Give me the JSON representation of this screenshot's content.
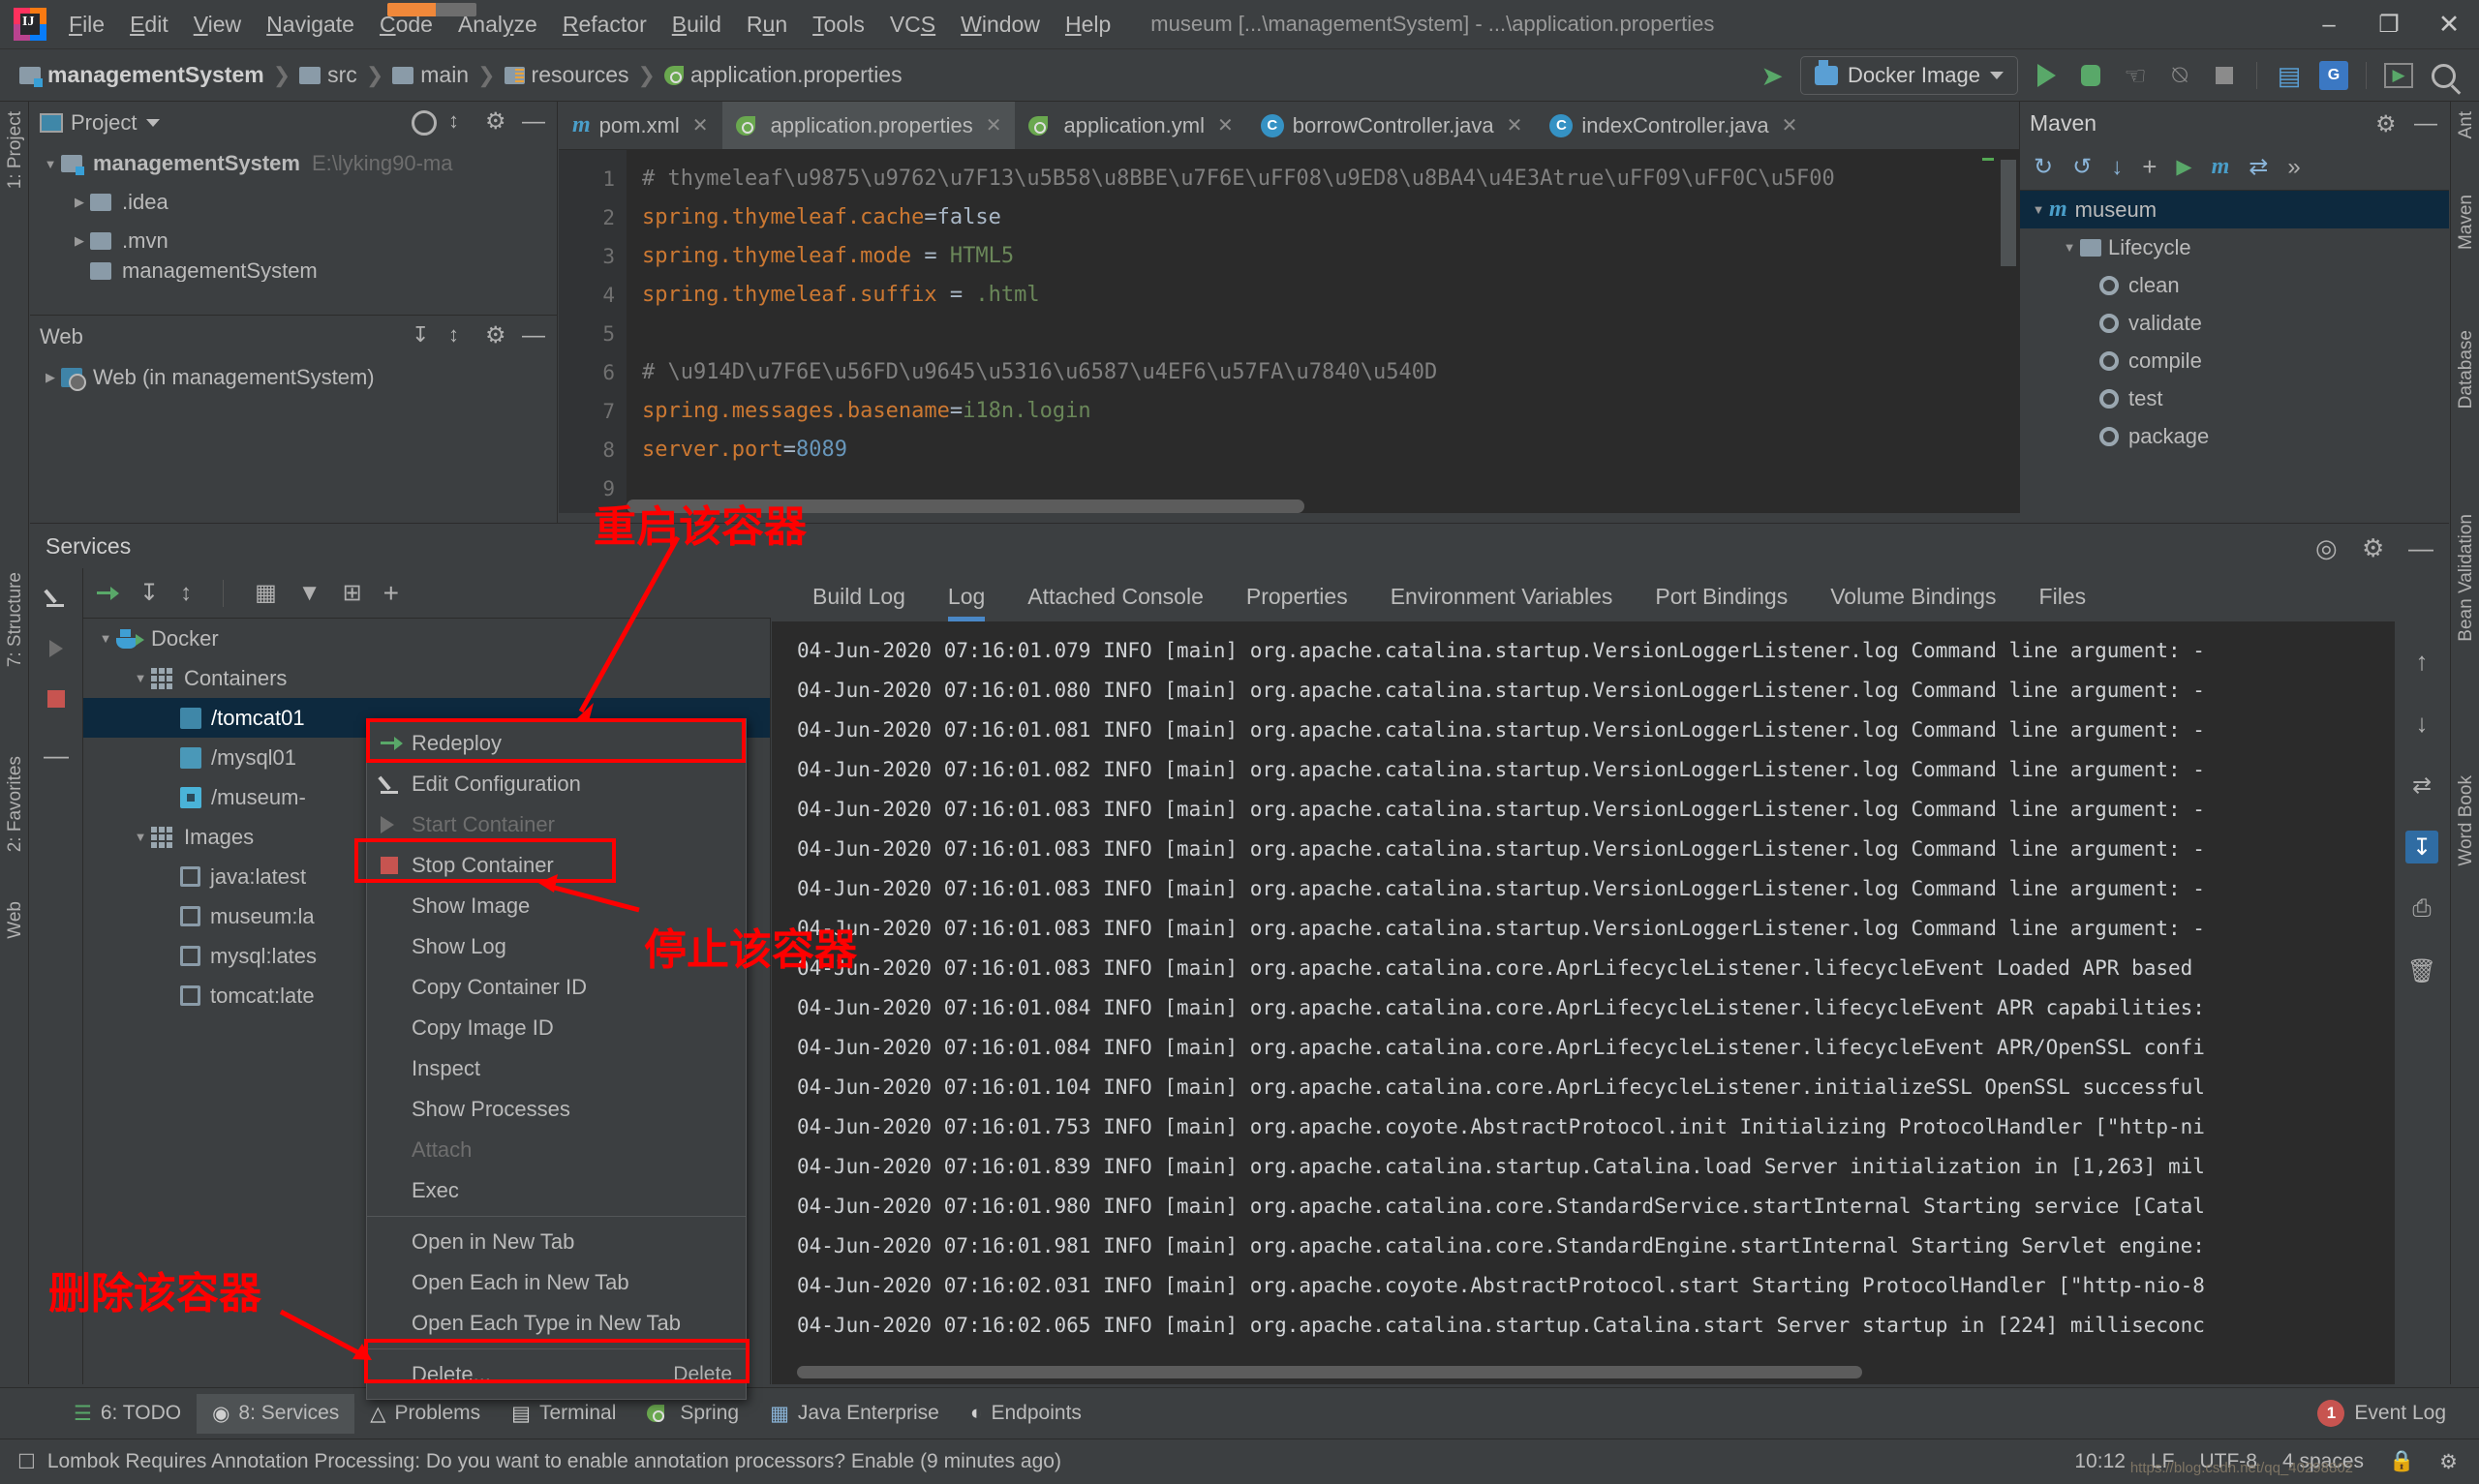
{
  "app": {
    "window_title": "museum [...\\managementSystem] - ...\\application.properties",
    "menu": [
      "File",
      "Edit",
      "View",
      "Navigate",
      "Code",
      "Analyze",
      "Refactor",
      "Build",
      "Run",
      "Tools",
      "VCS",
      "Window",
      "Help"
    ],
    "window_controls": {
      "minimize": "–",
      "restore": "❐",
      "close": "✕"
    }
  },
  "breadcrumb": {
    "items": [
      {
        "label": "managementSystem",
        "icon": "module-folder-icon"
      },
      {
        "label": "src",
        "icon": "folder-icon"
      },
      {
        "label": "main",
        "icon": "folder-icon"
      },
      {
        "label": "resources",
        "icon": "resources-folder-icon"
      },
      {
        "label": "application.properties",
        "icon": "spring-leaf-icon"
      }
    ],
    "separator": "❯"
  },
  "toolbar": {
    "run_config": "Docker Image",
    "icons": [
      "back-arrow-icon",
      "docker-image-icon",
      "run-icon",
      "debug-icon",
      "run-with-coverage-icon",
      "profile-icon",
      "stop-icon",
      "project-structure-icon",
      "translate-icon",
      "terminal-icon",
      "search-everywhere-icon"
    ]
  },
  "left_strip": {
    "tabs": [
      "1: Project",
      "7: Structure",
      "2: Favorites",
      "Web"
    ]
  },
  "right_strip": {
    "tabs": [
      "Ant",
      "Maven",
      "Database",
      "Bean Validation",
      "Word Book"
    ]
  },
  "project_panel": {
    "title": "Project",
    "tree": [
      {
        "label": "managementSystem",
        "path": "E:\\lyking90-ma",
        "arrow": "▼",
        "icon": "module-folder-icon",
        "depth": 0,
        "bold": true
      },
      {
        "label": ".idea",
        "path": "",
        "arrow": "▶",
        "icon": "folder-icon",
        "depth": 1,
        "bold": false
      },
      {
        "label": ".mvn",
        "path": "",
        "arrow": "▶",
        "icon": "folder-icon",
        "depth": 1,
        "bold": false
      },
      {
        "label": "managementSystem",
        "path": "",
        "arrow": "",
        "icon": "folder-icon",
        "depth": 1,
        "bold": false
      }
    ]
  },
  "web_panel": {
    "title": "Web",
    "tree": [
      {
        "label": "Web (in managementSystem)",
        "arrow": "▶",
        "icon": "web-module-icon"
      }
    ]
  },
  "editor": {
    "tabs": [
      {
        "label": "pom.xml",
        "icon": "maven-m-icon",
        "active": false,
        "closeable": true
      },
      {
        "label": "application.properties",
        "icon": "spring-leaf-icon",
        "active": true,
        "closeable": true
      },
      {
        "label": "application.yml",
        "icon": "spring-leaf-icon",
        "active": false,
        "closeable": true
      },
      {
        "label": "borrowController.java",
        "icon": "java-class-icon",
        "active": false,
        "closeable": true
      },
      {
        "label": "indexController.java",
        "icon": "java-class-icon",
        "active": false,
        "closeable": true
      }
    ],
    "lines": [
      {
        "no": "1",
        "kind": "comment",
        "text": "# thymeleaf\\u9875\\u9762\\u7F13\\u5B58\\u8BBE\\u7F6E\\uFF08\\u9ED8\\u8BA4\\u4E3Atrue\\uFF09\\uFF0C\\u5F00"
      },
      {
        "no": "2",
        "kind": "kv",
        "key": "spring.thymeleaf.cache",
        "op": "=",
        "value": "false",
        "valkind": "plain"
      },
      {
        "no": "3",
        "kind": "kv",
        "key": "spring.thymeleaf.mode",
        "op": " = ",
        "value": "HTML5",
        "valkind": "green"
      },
      {
        "no": "4",
        "kind": "kv",
        "key": "spring.thymeleaf.suffix",
        "op": " = ",
        "value": ".html",
        "valkind": "green"
      },
      {
        "no": "5",
        "kind": "blank",
        "text": ""
      },
      {
        "no": "6",
        "kind": "comment",
        "text": "# \\u914D\\u7F6E\\u56FD\\u9645\\u5316\\u6587\\u4EF6\\u57FA\\u7840\\u540D"
      },
      {
        "no": "7",
        "kind": "kv",
        "key": "spring.messages.basename",
        "op": "=",
        "value": "i18n.login",
        "valkind": "green"
      },
      {
        "no": "8",
        "kind": "kv",
        "key": "server.port",
        "op": "=",
        "value": "8089",
        "valkind": "num"
      },
      {
        "no": "9",
        "kind": "blank",
        "text": ""
      }
    ]
  },
  "services": {
    "title": "Services",
    "toolbar_icons": [
      "redeploy-icon",
      "expand-all-icon",
      "collapse-all-icon",
      "group-by-icon",
      "filter-icon",
      "add-tab-icon",
      "add-icon"
    ],
    "side_icons": [
      "edit-configuration-icon",
      "start-container-icon",
      "stop-container-icon",
      "remove-icon"
    ],
    "tree": [
      {
        "label": "Docker",
        "arrow": "▼",
        "icon": "docker-whale-icon",
        "depth": 0,
        "selected": false
      },
      {
        "label": "Containers",
        "arrow": "▼",
        "icon": "containers-grid-icon",
        "depth": 1,
        "selected": false
      },
      {
        "label": "/tomcat01",
        "arrow": "",
        "icon": "container-running-icon",
        "depth": 2,
        "selected": true
      },
      {
        "label": "/mysql01",
        "arrow": "",
        "icon": "container-running-icon",
        "depth": 2,
        "selected": false
      },
      {
        "label": "/museum-",
        "arrow": "",
        "icon": "container-stopped-icon",
        "depth": 2,
        "selected": false
      },
      {
        "label": "Images",
        "arrow": "▼",
        "icon": "images-grid-icon",
        "depth": 1,
        "selected": false
      },
      {
        "label": "java:latest",
        "arrow": "",
        "icon": "image-icon",
        "depth": 2,
        "selected": false
      },
      {
        "label": "museum:la",
        "arrow": "",
        "icon": "image-icon",
        "depth": 2,
        "selected": false
      },
      {
        "label": "mysql:lates",
        "arrow": "",
        "icon": "image-icon",
        "depth": 2,
        "selected": false
      },
      {
        "label": "tomcat:late",
        "arrow": "",
        "icon": "image-icon",
        "depth": 2,
        "selected": false
      }
    ]
  },
  "context_menu": {
    "items": [
      {
        "label": "Redeploy",
        "icon": "redeploy-icon",
        "shortcut": "",
        "disabled": false,
        "sep_after": false
      },
      {
        "label": "Edit Configuration",
        "icon": "pencil-icon",
        "shortcut": "",
        "disabled": false,
        "sep_after": false
      },
      {
        "label": "Start Container",
        "icon": "play-icon",
        "shortcut": "",
        "disabled": true,
        "sep_after": false
      },
      {
        "label": "Stop Container",
        "icon": "stop-icon",
        "shortcut": "",
        "disabled": false,
        "sep_after": false
      },
      {
        "label": "Show Image",
        "icon": "",
        "shortcut": "",
        "disabled": false,
        "sep_after": false
      },
      {
        "label": "Show Log",
        "icon": "",
        "shortcut": "",
        "disabled": false,
        "sep_after": false
      },
      {
        "label": "Copy Container ID",
        "icon": "",
        "shortcut": "",
        "disabled": false,
        "sep_after": false
      },
      {
        "label": "Copy Image ID",
        "icon": "",
        "shortcut": "",
        "disabled": false,
        "sep_after": false
      },
      {
        "label": "Inspect",
        "icon": "",
        "shortcut": "",
        "disabled": false,
        "sep_after": false
      },
      {
        "label": "Show Processes",
        "icon": "",
        "shortcut": "",
        "disabled": false,
        "sep_after": false
      },
      {
        "label": "Attach",
        "icon": "",
        "shortcut": "",
        "disabled": true,
        "sep_after": false
      },
      {
        "label": "Exec",
        "icon": "",
        "shortcut": "",
        "disabled": false,
        "sep_after": true
      },
      {
        "label": "Open in New Tab",
        "icon": "",
        "shortcut": "",
        "disabled": false,
        "sep_after": false
      },
      {
        "label": "Open Each in New Tab",
        "icon": "",
        "shortcut": "",
        "disabled": false,
        "sep_after": false
      },
      {
        "label": "Open Each Type in New Tab",
        "icon": "",
        "shortcut": "",
        "disabled": false,
        "sep_after": true
      },
      {
        "label": "Delete...",
        "icon": "",
        "shortcut": "Delete",
        "disabled": false,
        "sep_after": false
      }
    ]
  },
  "log_panel": {
    "tabs": [
      {
        "label": "Build Log",
        "active": false
      },
      {
        "label": "Log",
        "active": true
      },
      {
        "label": "Attached Console",
        "active": false
      },
      {
        "label": "Properties",
        "active": false
      },
      {
        "label": "Environment Variables",
        "active": false
      },
      {
        "label": "Port Bindings",
        "active": false
      },
      {
        "label": "Volume Bindings",
        "active": false
      },
      {
        "label": "Files",
        "active": false
      }
    ],
    "lines": [
      "04-Jun-2020 07:16:01.079 INFO [main] org.apache.catalina.startup.VersionLoggerListener.log Command line argument: -",
      "04-Jun-2020 07:16:01.080 INFO [main] org.apache.catalina.startup.VersionLoggerListener.log Command line argument: -",
      "04-Jun-2020 07:16:01.081 INFO [main] org.apache.catalina.startup.VersionLoggerListener.log Command line argument: -",
      "04-Jun-2020 07:16:01.082 INFO [main] org.apache.catalina.startup.VersionLoggerListener.log Command line argument: -",
      "04-Jun-2020 07:16:01.083 INFO [main] org.apache.catalina.startup.VersionLoggerListener.log Command line argument: -",
      "04-Jun-2020 07:16:01.083 INFO [main] org.apache.catalina.startup.VersionLoggerListener.log Command line argument: -",
      "04-Jun-2020 07:16:01.083 INFO [main] org.apache.catalina.startup.VersionLoggerListener.log Command line argument: -",
      "04-Jun-2020 07:16:01.083 INFO [main] org.apache.catalina.startup.VersionLoggerListener.log Command line argument: -",
      "04-Jun-2020 07:16:01.083 INFO [main] org.apache.catalina.core.AprLifecycleListener.lifecycleEvent Loaded APR based",
      "04-Jun-2020 07:16:01.084 INFO [main] org.apache.catalina.core.AprLifecycleListener.lifecycleEvent APR capabilities:",
      "04-Jun-2020 07:16:01.084 INFO [main] org.apache.catalina.core.AprLifecycleListener.lifecycleEvent APR/OpenSSL confi",
      "04-Jun-2020 07:16:01.104 INFO [main] org.apache.catalina.core.AprLifecycleListener.initializeSSL OpenSSL successful",
      "04-Jun-2020 07:16:01.753 INFO [main] org.apache.coyote.AbstractProtocol.init Initializing ProtocolHandler [\"http-ni",
      "04-Jun-2020 07:16:01.839 INFO [main] org.apache.catalina.startup.Catalina.load Server initialization in [1,263] mil",
      "04-Jun-2020 07:16:01.980 INFO [main] org.apache.catalina.core.StandardService.startInternal Starting service [Catal",
      "04-Jun-2020 07:16:01.981 INFO [main] org.apache.catalina.core.StandardEngine.startInternal Starting Servlet engine:",
      "04-Jun-2020 07:16:02.031 INFO [main] org.apache.coyote.AbstractProtocol.start Starting ProtocolHandler [\"http-nio-8",
      "04-Jun-2020 07:16:02.065 INFO [main] org.apache.catalina.startup.Catalina.start Server startup in [224] milliseconc"
    ],
    "side_icons": [
      "scroll-up-icon",
      "scroll-down-icon",
      "soft-wrap-icon",
      "scroll-to-end-icon",
      "print-icon",
      "clear-all-icon"
    ]
  },
  "maven_panel": {
    "title": "Maven",
    "tree": [
      {
        "label": "museum",
        "arrow": "▼",
        "icon": "maven-project-icon",
        "depth": 0,
        "selected": true
      },
      {
        "label": "Lifecycle",
        "arrow": "▼",
        "icon": "lifecycle-folder-icon",
        "depth": 1,
        "selected": false
      },
      {
        "label": "clean",
        "arrow": "",
        "icon": "maven-goal-icon",
        "depth": 2,
        "selected": false
      },
      {
        "label": "validate",
        "arrow": "",
        "icon": "maven-goal-icon",
        "depth": 2,
        "selected": false
      },
      {
        "label": "compile",
        "arrow": "",
        "icon": "maven-goal-icon",
        "depth": 2,
        "selected": false
      },
      {
        "label": "test",
        "arrow": "",
        "icon": "maven-goal-icon",
        "depth": 2,
        "selected": false
      },
      {
        "label": "package",
        "arrow": "",
        "icon": "maven-goal-icon",
        "depth": 2,
        "selected": false
      }
    ],
    "toolbar_icons": [
      "reload-icon",
      "generate-sources-icon",
      "download-sources-icon",
      "add-icon",
      "run-icon",
      "maven-settings-icon",
      "toggle-offline-icon",
      "more-icon"
    ]
  },
  "bottom_tool_window_bar": {
    "items": [
      {
        "label": "6: TODO",
        "icon": "todo-icon",
        "selected": false
      },
      {
        "label": "8: Services",
        "icon": "services-icon",
        "selected": true
      },
      {
        "label": "Problems",
        "icon": "problems-icon",
        "selected": false
      },
      {
        "label": "Terminal",
        "icon": "terminal-icon",
        "selected": false
      },
      {
        "label": "Spring",
        "icon": "spring-leaf-icon",
        "selected": false
      },
      {
        "label": "Java Enterprise",
        "icon": "java-enterprise-icon",
        "selected": false
      },
      {
        "label": "Endpoints",
        "icon": "endpoints-icon",
        "selected": false
      }
    ],
    "event_log": {
      "label": "Event Log",
      "count": "1"
    }
  },
  "status_bar": {
    "message": "Lombok Requires Annotation Processing: Do you want to enable annotation processors? Enable (9 minutes ago)",
    "time": "10:12",
    "line_sep": "LF",
    "encoding": "UTF-8",
    "indent": "4 spaces",
    "watermark": "https://blog.csdn.net/qq_40298802"
  },
  "annotations": {
    "restart": "重启该容器",
    "stop": "停止该容器",
    "delete": "删除该容器",
    "color": "#ff0000"
  }
}
